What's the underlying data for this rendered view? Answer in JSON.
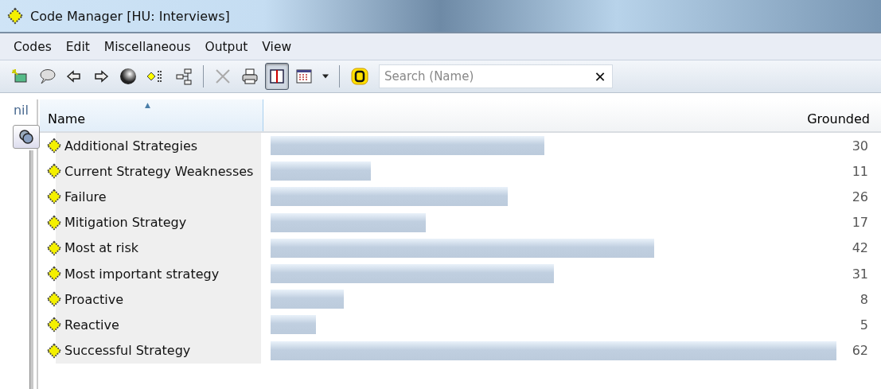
{
  "window": {
    "title": "Code Manager [HU: Interviews]"
  },
  "menu": [
    "Codes",
    "Edit",
    "Miscellaneous",
    "Output",
    "View"
  ],
  "toolbar": [
    {
      "kind": "new",
      "pressed": false
    },
    {
      "kind": "comment",
      "pressed": false
    },
    {
      "kind": "back",
      "pressed": false
    },
    {
      "kind": "forward",
      "pressed": false
    },
    {
      "kind": "sphere",
      "pressed": false
    },
    {
      "kind": "codelist",
      "pressed": false
    },
    {
      "kind": "tree",
      "pressed": false
    },
    {
      "kind": "sep"
    },
    {
      "kind": "delete",
      "pressed": false
    },
    {
      "kind": "print",
      "pressed": false
    },
    {
      "kind": "split",
      "pressed": true
    },
    {
      "kind": "grid",
      "pressed": false
    },
    {
      "kind": "caret",
      "pressed": false
    },
    {
      "kind": "sep"
    },
    {
      "kind": "filter",
      "pressed": false
    }
  ],
  "search": {
    "placeholder": "Search (Name)",
    "clear": "✕"
  },
  "side_panel": {
    "label": "nil"
  },
  "table": {
    "columns": [
      "Name",
      "Grounded"
    ],
    "sort_indicator": "▲",
    "rows": [
      {
        "name": "Additional Strategies",
        "grounded": "30"
      },
      {
        "name": "Current Strategy Weaknesses",
        "grounded": "11"
      },
      {
        "name": "Failure",
        "grounded": "26"
      },
      {
        "name": "Mitigation Strategy",
        "grounded": "17"
      },
      {
        "name": "Most at risk",
        "grounded": "42"
      },
      {
        "name": "Most important strategy",
        "grounded": "31"
      },
      {
        "name": "Proactive",
        "grounded": "8"
      },
      {
        "name": "Reactive",
        "grounded": "5"
      },
      {
        "name": "Successful Strategy",
        "grounded": "62"
      }
    ]
  }
}
